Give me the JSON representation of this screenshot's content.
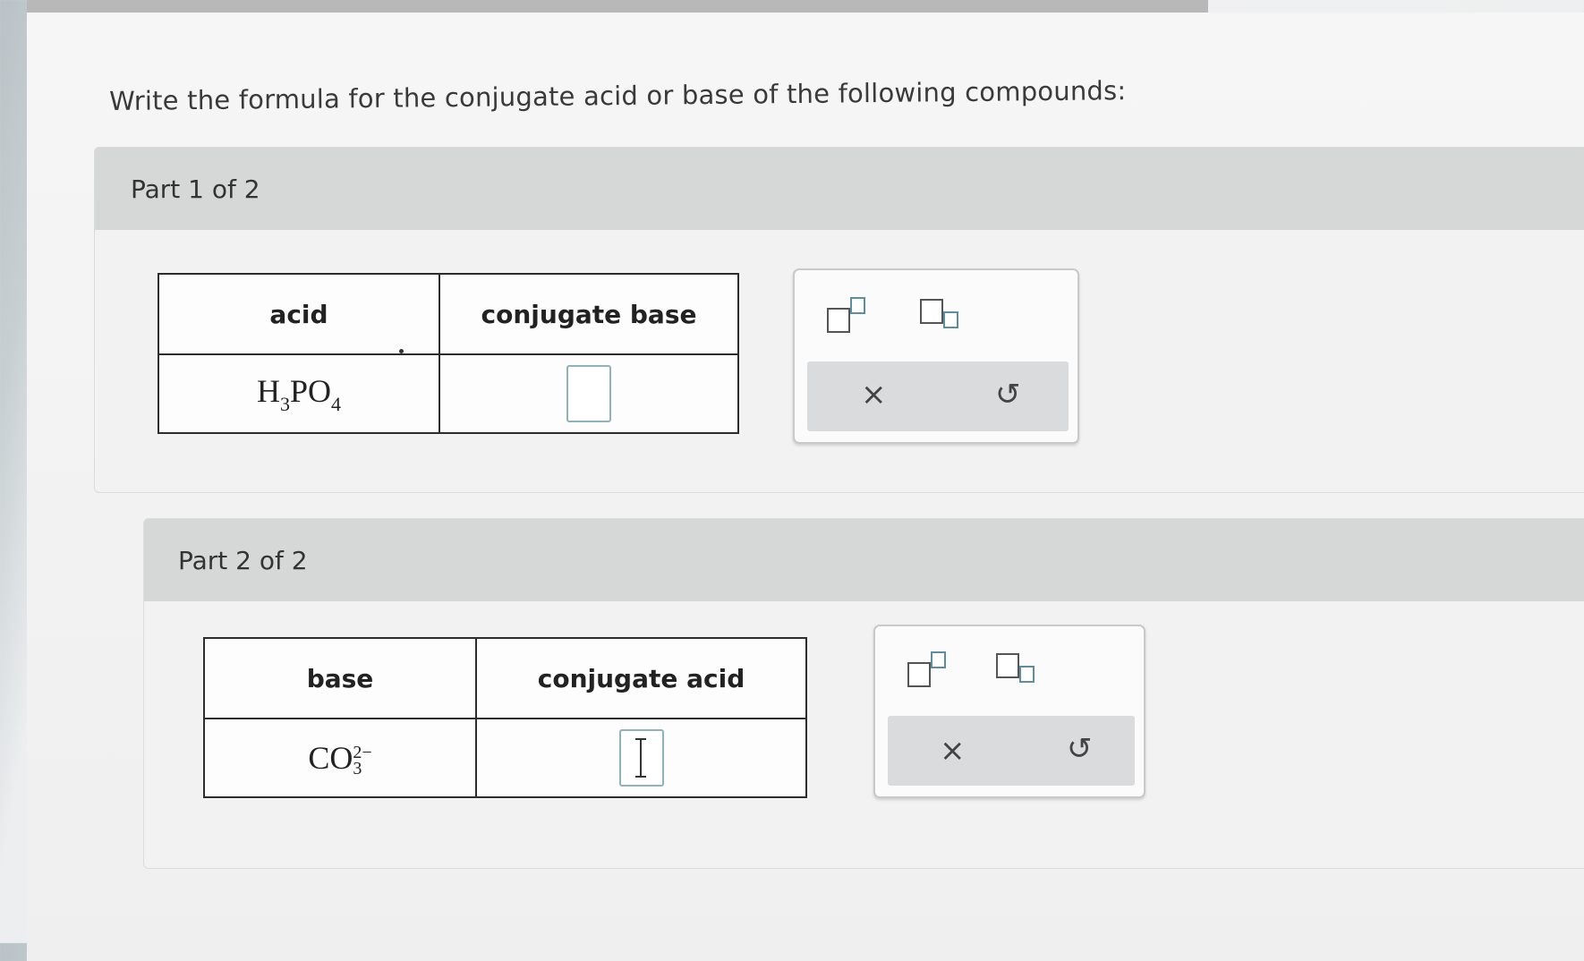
{
  "question": "Write the formula for the conjugate acid or base of the following compounds:",
  "parts": [
    {
      "title": "Part 1 of 2",
      "col1_header": "acid",
      "col2_header": "conjugate base",
      "formula": {
        "main": "H",
        "sub1": "3",
        "mid": "PO",
        "sub2": "4"
      }
    },
    {
      "title": "Part 2 of 2",
      "col1_header": "base",
      "col2_header": "conjugate acid",
      "formula": {
        "main": "CO",
        "sup": "2−",
        "sub": "3"
      }
    }
  ],
  "tools": {
    "superscript_icon": "superscript-icon",
    "subscript_icon": "subscript-icon",
    "clear_icon": "×",
    "undo_icon": "↺"
  }
}
